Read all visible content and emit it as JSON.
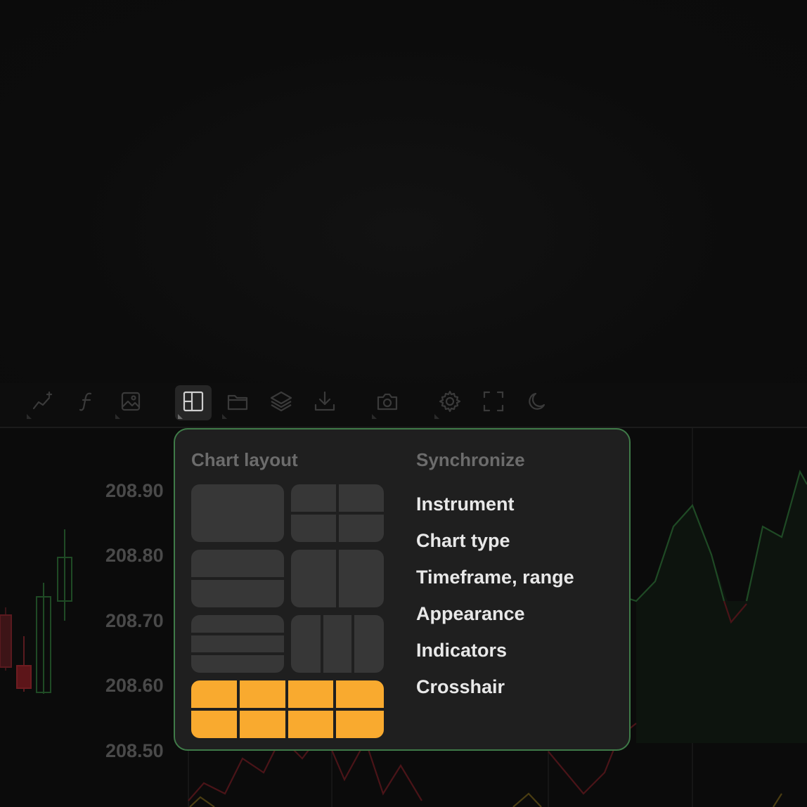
{
  "toolbar": {
    "buttons": [
      {
        "name": "add-trend-line",
        "icon": "trend-line-plus-icon"
      },
      {
        "name": "indicators",
        "icon": "function-icon"
      },
      {
        "name": "drawings",
        "icon": "image-frame-icon"
      },
      {
        "name": "chart-layout",
        "icon": "layout-icon",
        "active": true
      },
      {
        "name": "open",
        "icon": "folder-icon"
      },
      {
        "name": "layers",
        "icon": "layers-icon"
      },
      {
        "name": "download",
        "icon": "download-icon"
      },
      {
        "name": "screenshot",
        "icon": "camera-icon"
      },
      {
        "name": "settings",
        "icon": "gear-icon"
      },
      {
        "name": "fullscreen",
        "icon": "fullscreen-icon"
      },
      {
        "name": "theme",
        "icon": "moon-icon"
      }
    ]
  },
  "price_axis": [
    "208.90",
    "208.80",
    "208.70",
    "208.60",
    "208.50"
  ],
  "popup": {
    "layout_title": "Chart layout",
    "sync_title": "Synchronize",
    "layouts": [
      "single",
      "2x2-grid",
      "2-rows",
      "2-columns",
      "3-rows",
      "3-columns",
      "2x4-grid"
    ],
    "selected_layout": "2x4-grid",
    "sync_items": [
      "Instrument",
      "Chart type",
      "Timeframe, range",
      "Appearance",
      "Indicators",
      "Crosshair"
    ]
  },
  "colors": {
    "accent": "#f9aa2f",
    "popup_border": "#3f7a48",
    "popup_bg": "#1f1f1f",
    "candle_up": "#2f7a37",
    "candle_down": "#8c1f25"
  }
}
